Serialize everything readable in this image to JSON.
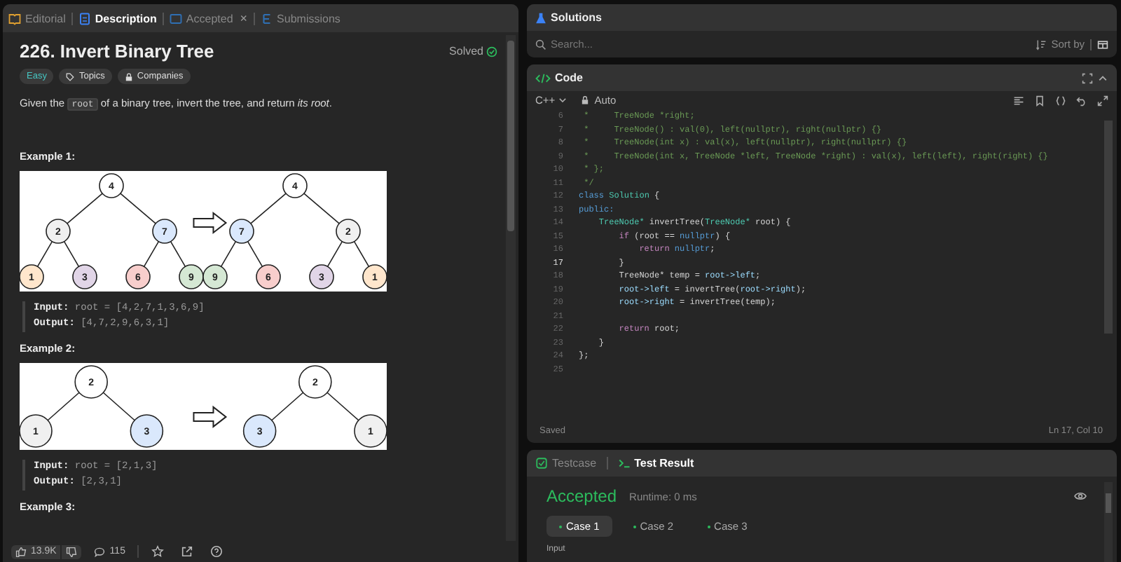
{
  "left_tabs": [
    {
      "label": "Editorial",
      "selected": false
    },
    {
      "label": "Description",
      "selected": true
    },
    {
      "label": "Accepted",
      "selected": false,
      "close": "×"
    },
    {
      "label": "Submissions",
      "selected": false
    }
  ],
  "problem": {
    "title": "226. Invert Binary Tree",
    "status": "Solved",
    "tags": [
      {
        "label": "Easy",
        "kind": "difficulty"
      },
      {
        "label": "Topics",
        "kind": "topics"
      },
      {
        "label": "Companies",
        "kind": "companies"
      }
    ],
    "statement": [
      {
        "text": "Given the ",
        "kind": "text"
      },
      {
        "text": "root",
        "kind": "code"
      },
      {
        "text": " of a binary tree, invert the tree, and return *its root*.",
        "kind": "text"
      }
    ]
  },
  "examples": [
    {
      "title": "Example 1:",
      "trees": [
        {
          "label": "4",
          "color": "#ffffff",
          "children": [
            {
              "label": "2",
              "color": "#f0f0f0",
              "children": [
                {
                  "label": "1",
                  "color": "#ffe6cc"
                },
                {
                  "label": "3",
                  "color": "#e1d5e7"
                }
              ]
            },
            {
              "label": "7",
              "color": "#dae8fc",
              "children": [
                {
                  "label": "6",
                  "color": "#f8cecc"
                },
                {
                  "label": "9",
                  "color": "#d5e8d4"
                }
              ]
            }
          ]
        },
        {
          "label": "4",
          "color": "#ffffff",
          "children": [
            {
              "label": "7",
              "color": "#dae8fc",
              "children": [
                {
                  "label": "9",
                  "color": "#d5e8d4"
                },
                {
                  "label": "6",
                  "color": "#f8cecc"
                }
              ]
            },
            {
              "label": "2",
              "color": "#f0f0f0",
              "children": [
                {
                  "label": "3",
                  "color": "#e1d5e7"
                },
                {
                  "label": "1",
                  "color": "#ffe6cc"
                }
              ]
            }
          ]
        }
      ],
      "input": "**Input:** root = [4,2,7,1,3,6,9]",
      "output": "**Output:** [4,7,2,9,6,3,1]"
    },
    {
      "title": "Example 2:",
      "trees": [
        {
          "label": "2",
          "color": "#ffffff",
          "children": [
            {
              "label": "1",
              "color": "#f0f0f0"
            },
            {
              "label": "3",
              "color": "#dae8fc"
            }
          ]
        },
        {
          "label": "2",
          "color": "#ffffff",
          "children": [
            {
              "label": "3",
              "color": "#dae8fc"
            },
            {
              "label": "1",
              "color": "#f0f0f0"
            }
          ]
        }
      ],
      "input": "**Input:** root = [2,1,3]",
      "output": "**Output:** [2,3,1]"
    },
    {
      "title": "Example 3:"
    }
  ],
  "footer": {
    "likes": "13.9K",
    "comments": "115"
  },
  "solutions": {
    "title": "Solutions",
    "search_placeholder": "Search...",
    "sort_label": "Sort by"
  },
  "code": {
    "title": "Code",
    "language": "C++",
    "mode": "Auto",
    "status": "Saved",
    "cursor": "Ln 17, Col 10",
    "lines": [
      {
        "number": "6",
        "current": false,
        "tokens": [
          {
            "text": " *     TreeNode *right;",
            "kind": "comment"
          }
        ]
      },
      {
        "number": "7",
        "current": false,
        "tokens": [
          {
            "text": " *     TreeNode() : val(0), left(nullptr), right(nullptr) {}",
            "kind": "comment"
          }
        ]
      },
      {
        "number": "8",
        "current": false,
        "tokens": [
          {
            "text": " *     TreeNode(int x) : val(x), left(nullptr), right(nullptr) {}",
            "kind": "comment"
          }
        ]
      },
      {
        "number": "9",
        "current": false,
        "tokens": [
          {
            "text": " *     TreeNode(int x, TreeNode *left, TreeNode *right) : val(x), left(left), right(right) {}",
            "kind": "comment"
          }
        ]
      },
      {
        "number": "10",
        "current": false,
        "tokens": [
          {
            "text": " * };",
            "kind": "comment"
          }
        ]
      },
      {
        "number": "11",
        "current": false,
        "tokens": [
          {
            "text": " */",
            "kind": "comment"
          }
        ]
      },
      {
        "number": "12",
        "current": false,
        "tokens": [
          {
            "text": "class",
            "kind": "keyword"
          },
          {
            "text": " Solution",
            "kind": "type"
          },
          {
            "text": " {",
            "kind": "plain"
          }
        ]
      },
      {
        "number": "13",
        "current": false,
        "tokens": [
          {
            "text": "public:",
            "kind": "keyword"
          }
        ]
      },
      {
        "number": "14",
        "current": false,
        "tokens": [
          {
            "text": "    TreeNode*",
            "kind": "type"
          },
          {
            "text": " invertTree(",
            "kind": "plain"
          },
          {
            "text": "TreeNode*",
            "kind": "type"
          },
          {
            "text": " root) {",
            "kind": "plain"
          }
        ]
      },
      {
        "number": "15",
        "current": false,
        "tokens": [
          {
            "text": "        if",
            "kind": "control"
          },
          {
            "text": " (root == ",
            "kind": "plain"
          },
          {
            "text": "nullptr",
            "kind": "keyword"
          },
          {
            "text": ") {",
            "kind": "plain"
          }
        ]
      },
      {
        "number": "16",
        "current": false,
        "tokens": [
          {
            "text": "            return",
            "kind": "control"
          },
          {
            "text": " nullptr",
            "kind": "keyword"
          },
          {
            "text": ";",
            "kind": "plain"
          }
        ]
      },
      {
        "number": "17",
        "current": true,
        "tokens": [
          {
            "text": "        }",
            "kind": "plain"
          }
        ]
      },
      {
        "number": "18",
        "current": false,
        "tokens": [
          {
            "text": "        TreeNode* temp = ",
            "kind": "plain"
          },
          {
            "text": "root->left",
            "kind": "variable"
          },
          {
            "text": ";",
            "kind": "plain"
          }
        ]
      },
      {
        "number": "19",
        "current": false,
        "tokens": [
          {
            "text": "        root->left",
            "kind": "variable"
          },
          {
            "text": " = invertTree(",
            "kind": "plain"
          },
          {
            "text": "root->right",
            "kind": "variable"
          },
          {
            "text": ");",
            "kind": "plain"
          }
        ]
      },
      {
        "number": "20",
        "current": false,
        "tokens": [
          {
            "text": "        root->right",
            "kind": "variable"
          },
          {
            "text": " = invertTree(temp);",
            "kind": "plain"
          }
        ]
      },
      {
        "number": "21",
        "current": false
      },
      {
        "number": "22",
        "current": false,
        "tokens": [
          {
            "text": "        return",
            "kind": "control"
          },
          {
            "text": " root;",
            "kind": "plain"
          }
        ]
      },
      {
        "number": "23",
        "current": false,
        "tokens": [
          {
            "text": "    }",
            "kind": "plain"
          }
        ]
      },
      {
        "number": "24",
        "current": false,
        "tokens": [
          {
            "text": "};",
            "kind": "plain"
          }
        ]
      },
      {
        "number": "25",
        "current": false
      }
    ]
  },
  "result_tabs": [
    {
      "label": "Testcase",
      "selected": false
    },
    {
      "label": "Test Result",
      "selected": true
    }
  ],
  "result": {
    "verdict": "Accepted",
    "runtime": "Runtime: 0 ms",
    "cases": [
      {
        "label": "Case 1",
        "selected": true
      },
      {
        "label": "Case 2",
        "selected": false
      },
      {
        "label": "Case 3",
        "selected": false
      }
    ],
    "input_label": "Input"
  }
}
